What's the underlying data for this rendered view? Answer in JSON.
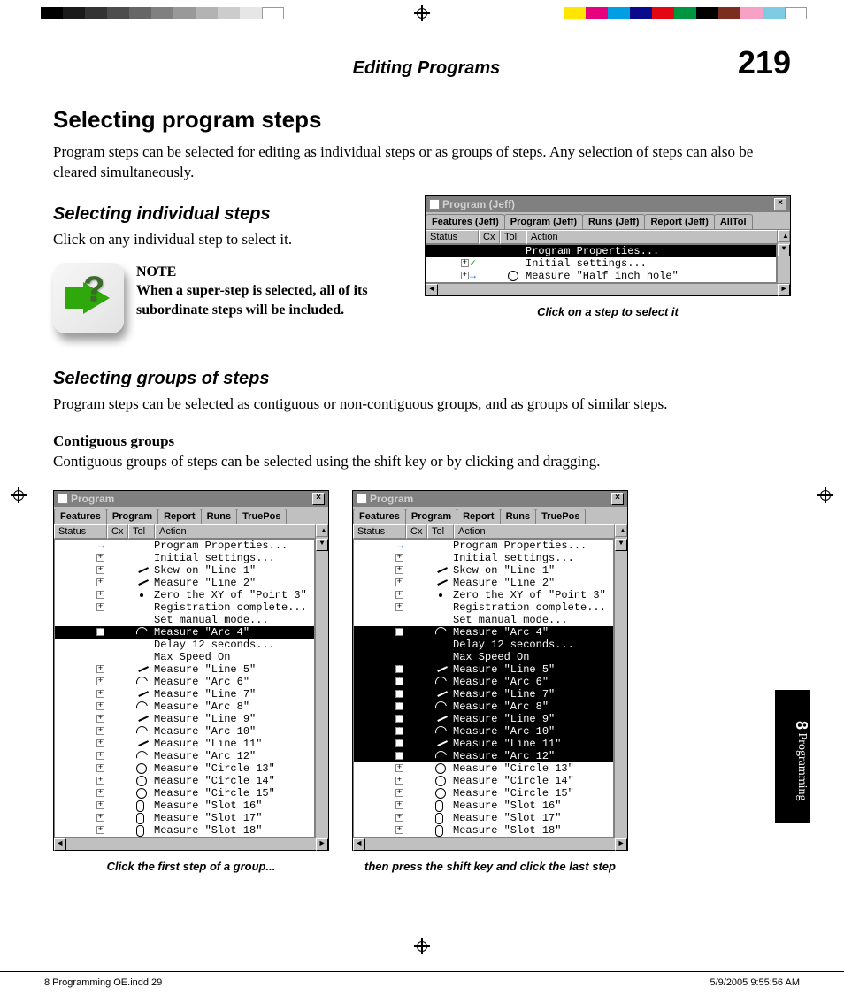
{
  "header": {
    "title": "Editing Programs",
    "page_number": "219"
  },
  "h1": "Selecting program steps",
  "intro": "Program steps can be selected for editing as individual steps or as groups of steps.  Any selection of steps can also be cleared simultaneously.",
  "indiv": {
    "heading": "Selecting individual steps",
    "body": "Click on any individual step to select it.",
    "note_label": "NOTE",
    "note_body": "When a super-step is selected, all of its subordinate steps will be included."
  },
  "fig1": {
    "win_title": "Program (Jeff)",
    "tabs": [
      "Features (Jeff)",
      "Program (Jeff)",
      "Runs (Jeff)",
      "Report (Jeff)",
      "AllTol"
    ],
    "cols": {
      "status": "Status",
      "cx": "Cx",
      "tol": "Tol",
      "action": "Action"
    },
    "rows": [
      {
        "sel": true,
        "expand": "",
        "icon": "",
        "tol": "",
        "action": "Program Properties..."
      },
      {
        "sel": false,
        "expand": "+",
        "icon": "chk",
        "tol": "",
        "action": "Initial settings..."
      },
      {
        "sel": false,
        "expand": "+",
        "icon": "arr",
        "tol": "circ",
        "action": "Measure \"Half inch hole\""
      }
    ],
    "caption": "Click on a step to select it"
  },
  "groups": {
    "heading": "Selecting groups of steps",
    "body": "Program steps can be selected as contiguous or non-contiguous groups, and as groups of similar steps.",
    "sub_heading": "Contiguous groups",
    "sub_body": "Contiguous groups of steps can be selected using the shift key or by clicking and dragging."
  },
  "fig2_common": {
    "win_title": "Program",
    "tabs": [
      "Features",
      "Program",
      "Report",
      "Runs",
      "TruePos"
    ],
    "cols": {
      "status": "Status",
      "cx": "Cx",
      "tol": "Tol",
      "action": "Action"
    },
    "steps": [
      {
        "expand": "",
        "tol": "",
        "icon": "arr",
        "action": "Program Properties..."
      },
      {
        "expand": "+",
        "tol": "",
        "icon": "",
        "action": "Initial settings..."
      },
      {
        "expand": "+",
        "tol": "line",
        "icon": "",
        "action": "Skew on \"Line 1\""
      },
      {
        "expand": "+",
        "tol": "line",
        "icon": "",
        "action": "Measure \"Line 2\""
      },
      {
        "expand": "+",
        "tol": "dot",
        "icon": "",
        "action": "Zero the XY of \"Point 3\""
      },
      {
        "expand": "+",
        "tol": "",
        "icon": "",
        "action": "Registration complete..."
      },
      {
        "expand": "",
        "tol": "",
        "icon": "",
        "action": "Set manual mode..."
      },
      {
        "expand": "+",
        "tol": "arc",
        "icon": "",
        "action": "Measure \"Arc 4\""
      },
      {
        "expand": "",
        "tol": "",
        "icon": "",
        "action": "Delay 12 seconds..."
      },
      {
        "expand": "",
        "tol": "",
        "icon": "",
        "action": "Max Speed On"
      },
      {
        "expand": "+",
        "tol": "line",
        "icon": "",
        "action": "Measure \"Line 5\""
      },
      {
        "expand": "+",
        "tol": "arc",
        "icon": "",
        "action": "Measure \"Arc 6\""
      },
      {
        "expand": "+",
        "tol": "line",
        "icon": "",
        "action": "Measure \"Line 7\""
      },
      {
        "expand": "+",
        "tol": "arc",
        "icon": "",
        "action": "Measure \"Arc 8\""
      },
      {
        "expand": "+",
        "tol": "line",
        "icon": "",
        "action": "Measure \"Line 9\""
      },
      {
        "expand": "+",
        "tol": "arc",
        "icon": "",
        "action": "Measure \"Arc 10\""
      },
      {
        "expand": "+",
        "tol": "line",
        "icon": "",
        "action": "Measure \"Line 11\""
      },
      {
        "expand": "+",
        "tol": "arc",
        "icon": "",
        "action": "Measure \"Arc 12\""
      },
      {
        "expand": "+",
        "tol": "circ",
        "icon": "",
        "action": "Measure \"Circle 13\""
      },
      {
        "expand": "+",
        "tol": "circ",
        "icon": "",
        "action": "Measure \"Circle 14\""
      },
      {
        "expand": "+",
        "tol": "circ",
        "icon": "",
        "action": "Measure \"Circle 15\""
      },
      {
        "expand": "+",
        "tol": "slot",
        "icon": "",
        "action": "Measure \"Slot 16\""
      },
      {
        "expand": "+",
        "tol": "slot",
        "icon": "",
        "action": "Measure \"Slot 17\""
      },
      {
        "expand": "+",
        "tol": "slot",
        "icon": "",
        "action": "Measure \"Slot 18\""
      }
    ]
  },
  "fig2_left": {
    "selected": [
      7
    ],
    "caption": "Click the first step of a group..."
  },
  "fig2_right": {
    "selected": [
      7,
      8,
      9,
      10,
      11,
      12,
      13,
      14,
      15,
      16,
      17
    ],
    "caption": "then press the shift key and click the last step"
  },
  "sidetab": {
    "chapter": "8",
    "label": "Programming"
  },
  "footer": {
    "left": "8 Programming OE.indd   29",
    "right": "5/9/2005   9:55:56 AM"
  }
}
